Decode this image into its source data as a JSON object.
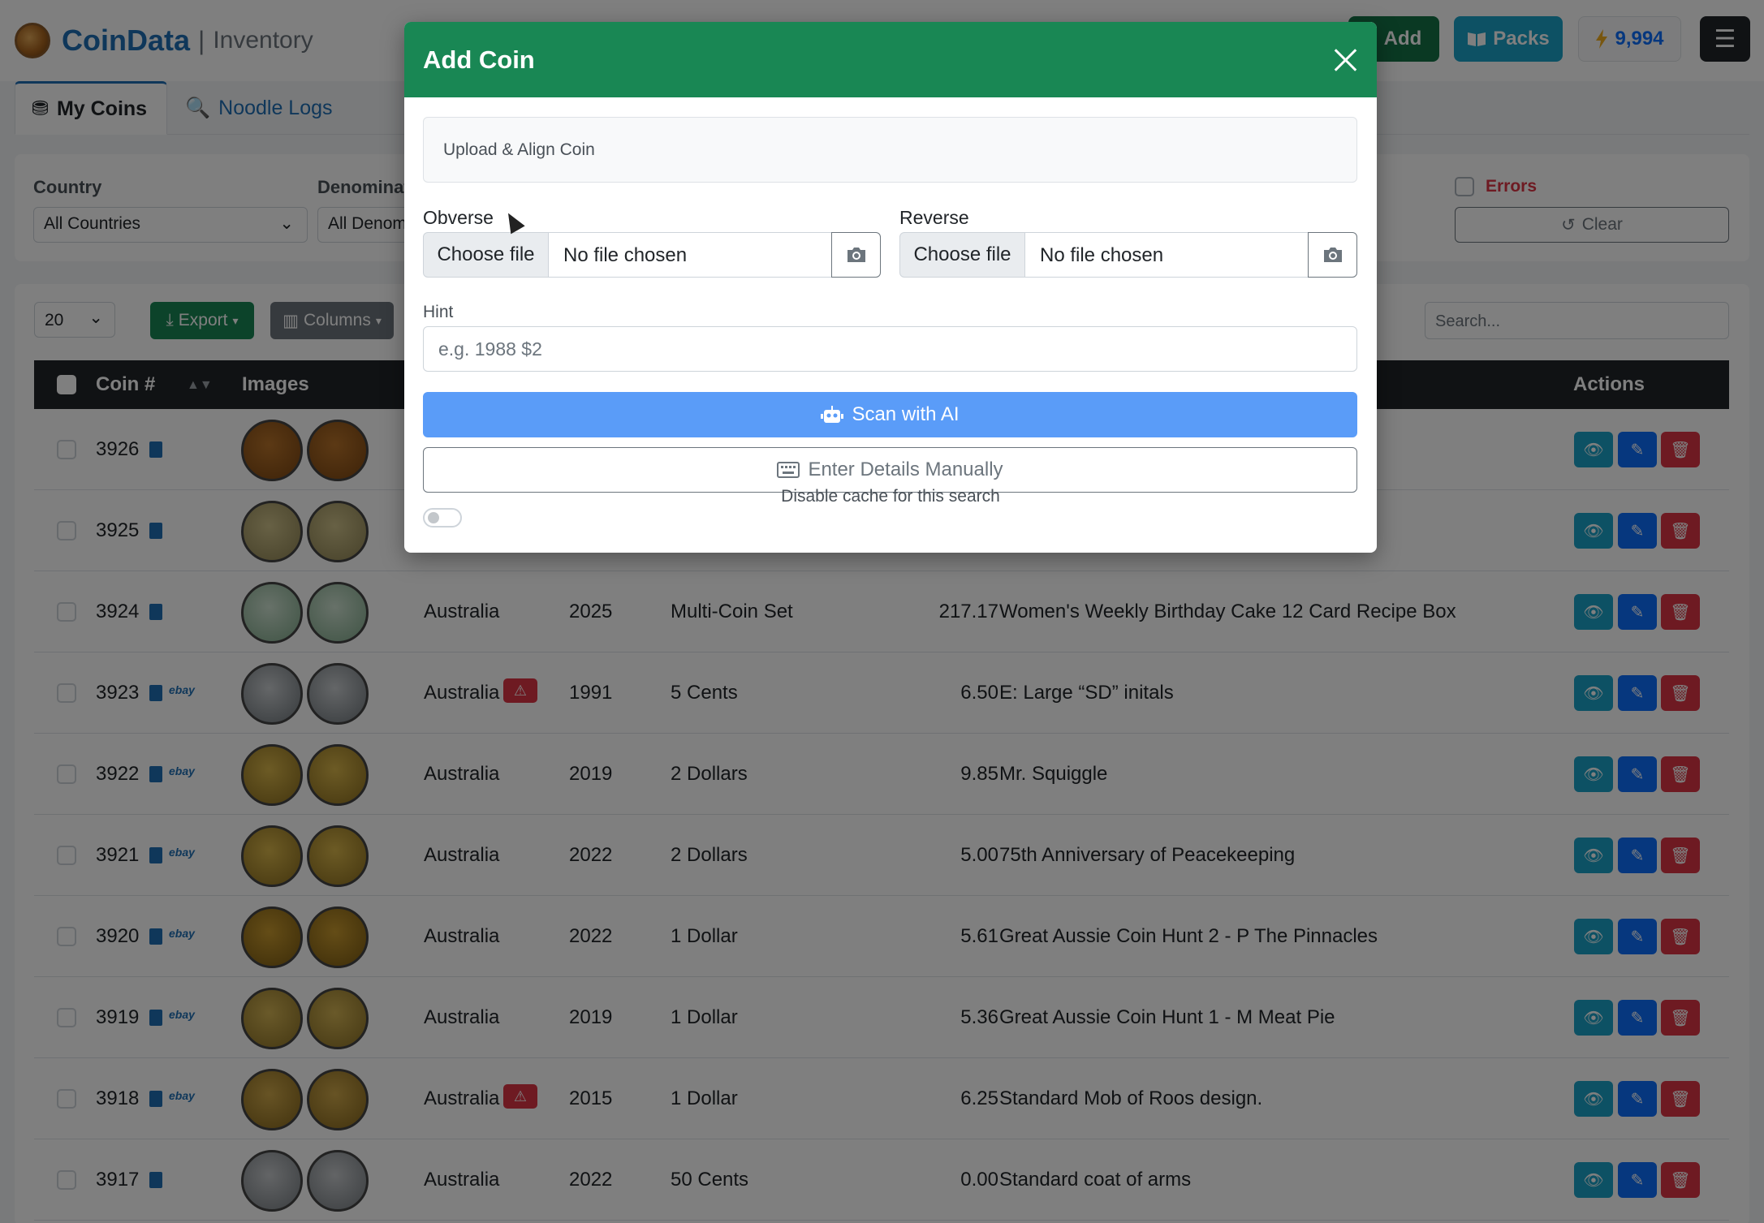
{
  "app": {
    "brand": "CoinData",
    "separator": "|",
    "section": "Inventory"
  },
  "header_buttons": {
    "add": "Add",
    "packs": "Packs",
    "credits": "9,994"
  },
  "tabs": [
    {
      "label": "My Coins",
      "active": true
    },
    {
      "label": "Noodle Logs",
      "active": false
    }
  ],
  "filters": {
    "country_label": "Country",
    "country_value": "All Countries",
    "denomination_label": "Denominat",
    "denomination_value": "All Denom",
    "errors_label": "Errors",
    "clear_label": "Clear"
  },
  "toolbar": {
    "page_size": "20",
    "export_label": "Export",
    "columns_label": "Columns",
    "search_placeholder": "Search..."
  },
  "table": {
    "headers": {
      "coin_no": "Coin #",
      "images": "Images",
      "actions": "Actions"
    },
    "rows": [
      {
        "id": "3926",
        "ebay": false,
        "country": "",
        "warn": false,
        "year": "",
        "denom": "",
        "price": "",
        "desc": ""
      },
      {
        "id": "3925",
        "ebay": false,
        "country": "",
        "warn": false,
        "year": "",
        "denom": "",
        "price": "",
        "desc": ""
      },
      {
        "id": "3924",
        "ebay": false,
        "country": "Australia",
        "warn": false,
        "year": "2025",
        "denom": "Multi-Coin Set",
        "price": "217.17",
        "desc": "Women's Weekly Birthday Cake 12 Card Recipe Box"
      },
      {
        "id": "3923",
        "ebay": true,
        "country": "Australia",
        "warn": true,
        "year": "1991",
        "denom": "5 Cents",
        "price": "6.50",
        "desc": "E: Large “SD” initals"
      },
      {
        "id": "3922",
        "ebay": true,
        "country": "Australia",
        "warn": false,
        "year": "2019",
        "denom": "2 Dollars",
        "price": "9.85",
        "desc": "Mr. Squiggle"
      },
      {
        "id": "3921",
        "ebay": true,
        "country": "Australia",
        "warn": false,
        "year": "2022",
        "denom": "2 Dollars",
        "price": "5.00",
        "desc": "75th Anniversary of Peacekeeping"
      },
      {
        "id": "3920",
        "ebay": true,
        "country": "Australia",
        "warn": false,
        "year": "2022",
        "denom": "1 Dollar",
        "price": "5.61",
        "desc": "Great Aussie Coin Hunt 2 - P The Pinnacles"
      },
      {
        "id": "3919",
        "ebay": true,
        "country": "Australia",
        "warn": false,
        "year": "2019",
        "denom": "1 Dollar",
        "price": "5.36",
        "desc": "Great Aussie Coin Hunt 1 - M Meat Pie"
      },
      {
        "id": "3918",
        "ebay": true,
        "country": "Australia",
        "warn": true,
        "year": "2015",
        "denom": "1 Dollar",
        "price": "6.25",
        "desc": "Standard Mob of Roos design."
      },
      {
        "id": "3917",
        "ebay": false,
        "country": "Australia",
        "warn": false,
        "year": "2022",
        "denom": "50 Cents",
        "price": "0.00",
        "desc": "Standard coat of arms"
      }
    ],
    "ebay_label": "ebay"
  },
  "modal": {
    "title": "Add Coin",
    "upload_title": "Upload & Align Coin",
    "obverse_label": "Obverse",
    "reverse_label": "Reverse",
    "choose_file": "Choose file",
    "no_file": "No file chosen",
    "hint_label": "Hint",
    "hint_placeholder": "e.g. 1988 $2",
    "scan_label": "Scan with AI",
    "manual_label": "Enter Details Manually",
    "cache_label": "Disable cache for this search"
  },
  "icons": {
    "brand": "coin-logo-icon",
    "packs": "book-open-icon",
    "credits": "lightning-icon",
    "menu": "hamburger-icon",
    "tab_coins": "coins-icon",
    "tab_logs": "search-dollar-icon",
    "export": "download-icon",
    "columns": "columns-icon",
    "camera": "camera-icon",
    "scan": "robot-icon",
    "manual": "keyboard-icon",
    "view": "eye-icon",
    "edit": "edit-icon",
    "delete": "trash-icon"
  },
  "colors": {
    "modal_header": "#198754",
    "scan_button": "#5a9cf8",
    "brand": "#1f6fb5",
    "danger": "#dc3545",
    "info": "#1aa3c8"
  }
}
